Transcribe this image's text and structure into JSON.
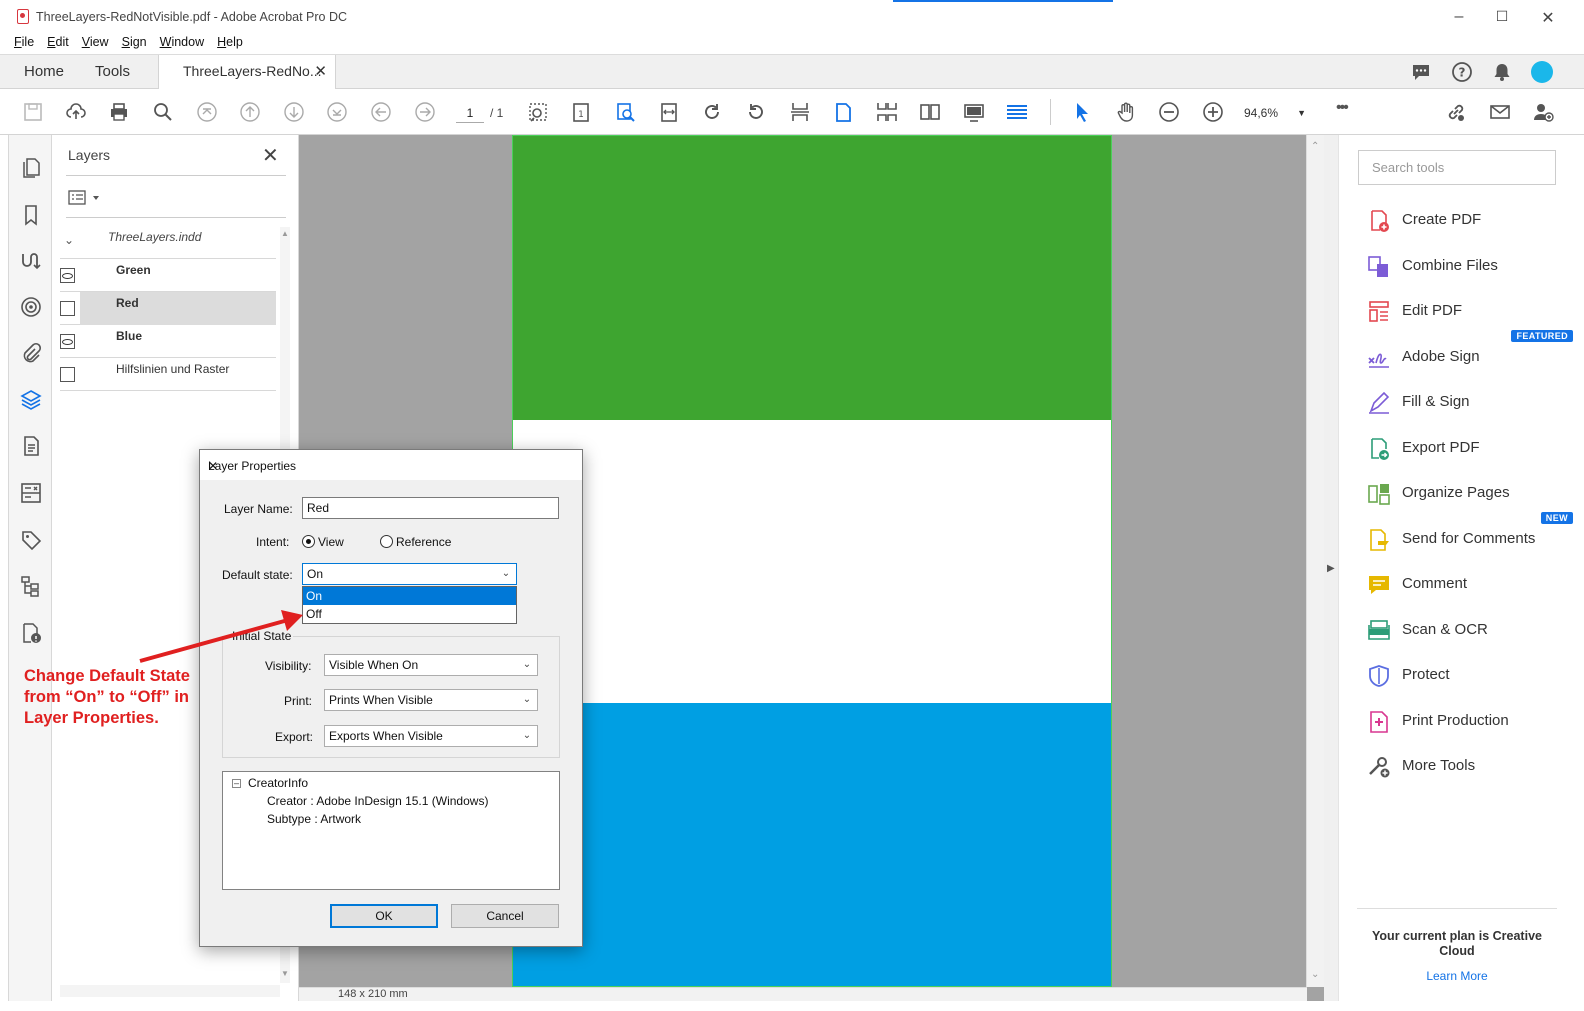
{
  "window": {
    "title": "ThreeLayers-RedNotVisible.pdf - Adobe Acrobat Pro DC",
    "minimize": "–",
    "maximize": "☐",
    "close": "✕"
  },
  "menu": [
    "File",
    "Edit",
    "View",
    "Sign",
    "Window",
    "Help"
  ],
  "tabs": {
    "home": "Home",
    "tools": "Tools",
    "doc": "ThreeLayers-RedNo...",
    "doc_close": "✕"
  },
  "toolbar": {
    "page_current": "1",
    "page_total": "/ 1",
    "zoom": "94,6%",
    "more": "•••"
  },
  "layers_panel": {
    "title": "Layers",
    "close": "✕",
    "root": "ThreeLayers.indd",
    "items": [
      {
        "label": "Green",
        "visible": true
      },
      {
        "label": "Red",
        "visible": false
      },
      {
        "label": "Blue",
        "visible": true
      },
      {
        "label": "Hilfslinien und Raster",
        "visible": false
      }
    ]
  },
  "document": {
    "page_size": "148 x 210 mm",
    "colors": {
      "green": "#3ea530",
      "white": "#ffffff",
      "blue": "#009fe3"
    }
  },
  "right_pane": {
    "search_placeholder": "Search tools",
    "tools": [
      {
        "label": "Create PDF",
        "icon": "create-pdf-icon",
        "color": "#e34850"
      },
      {
        "label": "Combine Files",
        "icon": "combine-files-icon",
        "color": "#7c5cd6"
      },
      {
        "label": "Edit PDF",
        "icon": "edit-pdf-icon",
        "color": "#e34850"
      },
      {
        "label": "Adobe Sign",
        "icon": "adobe-sign-icon",
        "color": "#7c5cd6",
        "badge": "FEATURED"
      },
      {
        "label": "Fill & Sign",
        "icon": "fill-sign-icon",
        "color": "#7c5cd6"
      },
      {
        "label": "Export PDF",
        "icon": "export-pdf-icon",
        "color": "#2d9d78"
      },
      {
        "label": "Organize Pages",
        "icon": "organize-pages-icon",
        "color": "#6aa84f"
      },
      {
        "label": "Send for Comments",
        "icon": "send-comments-icon",
        "color": "#e6b800",
        "badge": "NEW"
      },
      {
        "label": "Comment",
        "icon": "comment-icon",
        "color": "#e6b800"
      },
      {
        "label": "Scan & OCR",
        "icon": "scan-ocr-icon",
        "color": "#2d9d78"
      },
      {
        "label": "Protect",
        "icon": "protect-icon",
        "color": "#5b6ee1"
      },
      {
        "label": "Print Production",
        "icon": "print-production-icon",
        "color": "#d83790"
      },
      {
        "label": "More Tools",
        "icon": "more-tools-icon",
        "color": "#555555"
      }
    ],
    "plan_text": "Your current plan is Creative Cloud",
    "learn_more": "Learn More"
  },
  "dialog": {
    "title": "Layer Properties",
    "close": "✕",
    "layer_name_label": "Layer Name:",
    "layer_name_value": "Red",
    "intent_label": "Intent:",
    "intent_view": "View",
    "intent_reference": "Reference",
    "default_state_label": "Default state:",
    "default_state_value": "On",
    "default_state_options": [
      "On",
      "Off"
    ],
    "initial_state_legend": "Initial State",
    "visibility_label": "Visibility:",
    "visibility_value": "Visible When On",
    "print_label": "Print:",
    "print_value": "Prints When Visible",
    "export_label": "Export:",
    "export_value": "Exports When Visible",
    "creator_info": "CreatorInfo",
    "creator_line": "Creator : Adobe InDesign 15.1 (Windows)",
    "subtype_line": "Subtype : Artwork",
    "ok": "OK",
    "cancel": "Cancel"
  },
  "annotation": {
    "text": "Change Default State from “On” to “Off” in Layer Properties.",
    "color": "#e02020"
  }
}
